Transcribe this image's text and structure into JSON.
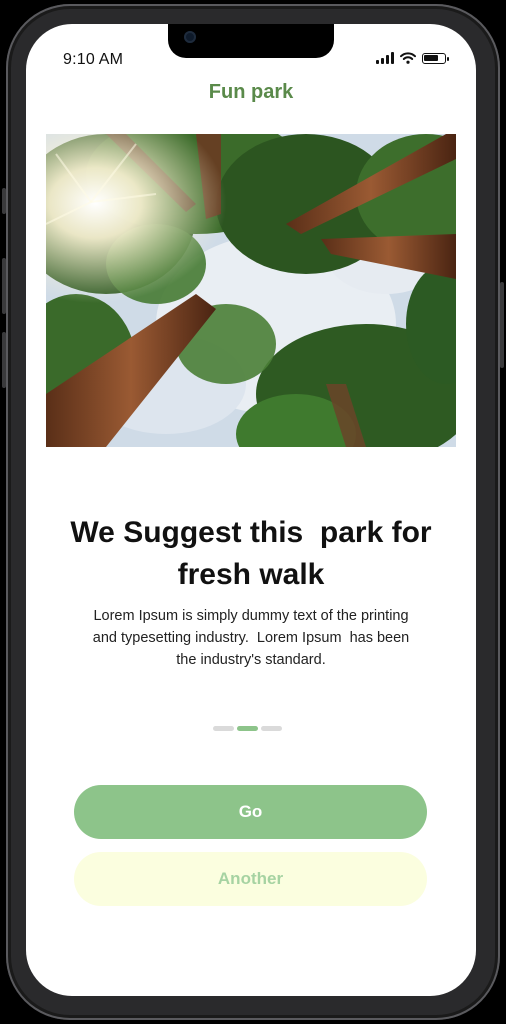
{
  "status_bar": {
    "time": "9:10 AM"
  },
  "app": {
    "title": "Fun park"
  },
  "hero": {
    "alt": "Looking up at tall redwood trees against a cloudy sky"
  },
  "content": {
    "heading_line1": "We Suggest this  park for",
    "heading_line2": "fresh walk",
    "body_line1": "Lorem Ipsum is simply dummy text of the printing",
    "body_line2": "and typesetting industry.  Lorem Ipsum  has been",
    "body_line3": "the industry's standard."
  },
  "pager": {
    "count": 3,
    "active_index": 1
  },
  "buttons": {
    "primary_label": "Go",
    "secondary_label": "Another"
  },
  "colors": {
    "accent": "#8dc48a",
    "title": "#5a8a4a",
    "secondary_bg": "#fbfedf"
  }
}
